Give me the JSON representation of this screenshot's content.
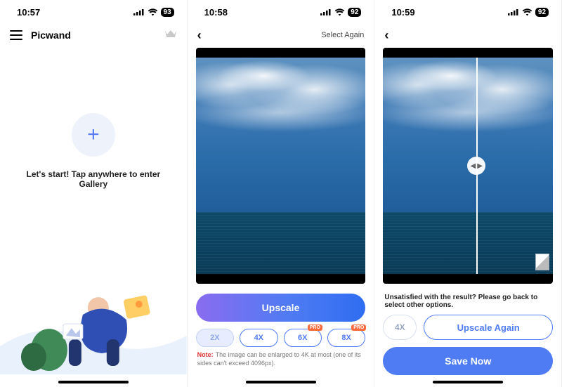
{
  "screen1": {
    "time": "10:57",
    "battery": "93",
    "app_title": "Picwand",
    "start_caption": "Let's start! Tap anywhere to enter Gallery"
  },
  "screen2": {
    "time": "10:58",
    "battery": "92",
    "select_again": "Select Again",
    "upscale_label": "Upscale",
    "scales": {
      "x2": "2X",
      "x4": "4X",
      "x6": "6X",
      "x8": "8X"
    },
    "pro_tag": "PRO",
    "note_prefix": "Note:",
    "note_text": "The image can be enlarged to 4K at most (one of its sides can't exceed 4096px)."
  },
  "screen3": {
    "time": "10:59",
    "battery": "92",
    "unsatisfied": "Unsatisfied with the result? Please go back to select other options.",
    "selected_scale": "4X",
    "upscale_again": "Upscale Again",
    "save_now": "Save Now"
  }
}
